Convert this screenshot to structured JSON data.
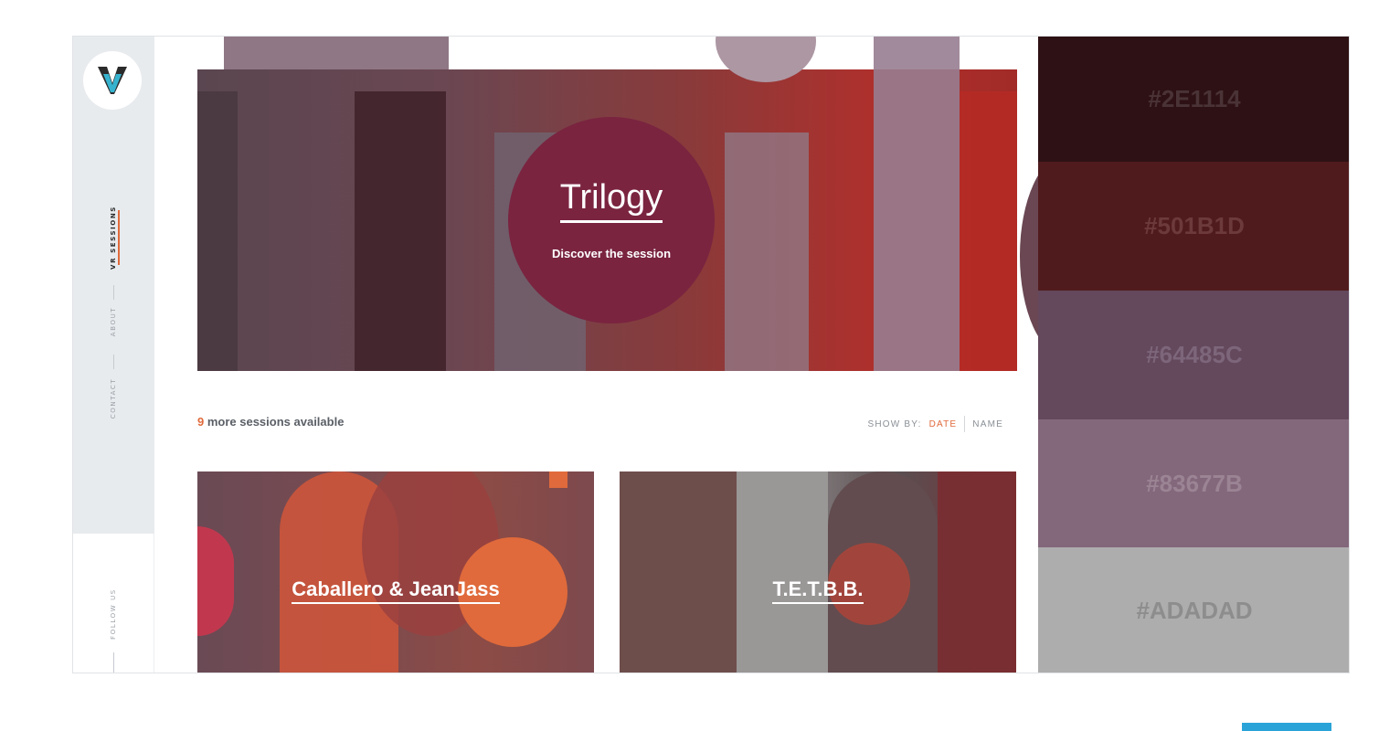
{
  "sidebar": {
    "logo_letter": "V",
    "nav": [
      {
        "label": "VR SESSIONS",
        "active": true
      },
      {
        "label": "ABOUT",
        "active": false
      },
      {
        "label": "CONTACT",
        "active": false
      }
    ],
    "follow_label": "FOLLOW US"
  },
  "hero": {
    "title": "Trilogy",
    "subtitle": "Discover the session"
  },
  "sessions": {
    "count": "9",
    "count_suffix": " more sessions available",
    "show_by_label": "SHOW BY:",
    "sort_date": "DATE",
    "sort_name": "NAME"
  },
  "cards": [
    {
      "title": "Caballero & JeanJass"
    },
    {
      "title": "T.E.T.B.B."
    }
  ],
  "palette": [
    {
      "hex": "#2E1114",
      "text_color": "#4a3336"
    },
    {
      "hex": "#501B1D",
      "text_color": "#6d3a3c"
    },
    {
      "hex": "#64485C",
      "text_color": "#7d667a"
    },
    {
      "hex": "#83677B",
      "text_color": "#9b8494"
    },
    {
      "hex": "#ADADAD",
      "text_color": "#8d8d8d"
    }
  ],
  "colors": {
    "accent": "#e06a3b",
    "hero_circle": "#7a2440",
    "bottom_bar": "#2aa4d8"
  }
}
